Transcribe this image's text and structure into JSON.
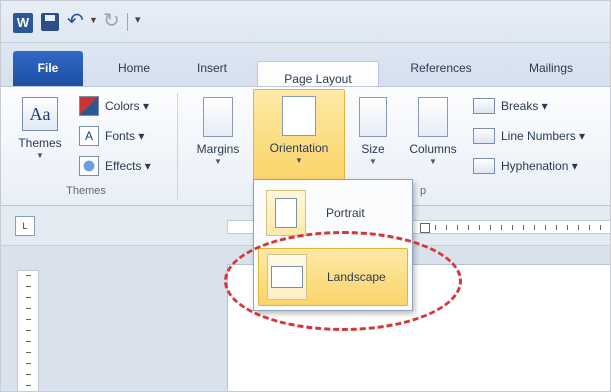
{
  "qat": {
    "logo": "W"
  },
  "tabs": [
    {
      "label": "File"
    },
    {
      "label": "Home"
    },
    {
      "label": "Insert"
    },
    {
      "label": "Page Layout"
    },
    {
      "label": "References"
    },
    {
      "label": "Mailings"
    }
  ],
  "ribbon": {
    "themes": {
      "label": "Themes",
      "icon_text": "Aa",
      "group_label": "Themes"
    },
    "colors": {
      "label": "Colors ▾"
    },
    "fonts": {
      "label": "Fonts ▾",
      "icon_text": "A"
    },
    "effects": {
      "label": "Effects ▾"
    },
    "margins": {
      "label": "Margins"
    },
    "orientation": {
      "label": "Orientation"
    },
    "size": {
      "label": "Size"
    },
    "columns": {
      "label": "Columns"
    },
    "breaks": {
      "label": "Breaks ▾"
    },
    "line_numbers": {
      "label": "Line Numbers ▾"
    },
    "hyphenation": {
      "label": "Hyphenation ▾"
    },
    "page_setup_group_partial": "p"
  },
  "dropdown": {
    "items": [
      {
        "label": "Portrait"
      },
      {
        "label": "Landscape"
      }
    ]
  },
  "ruler": {
    "corner": "L"
  },
  "colors": {
    "highlight": "#fbd46a",
    "file_tab": "#2f69c7",
    "annotation": "#d6363a"
  }
}
